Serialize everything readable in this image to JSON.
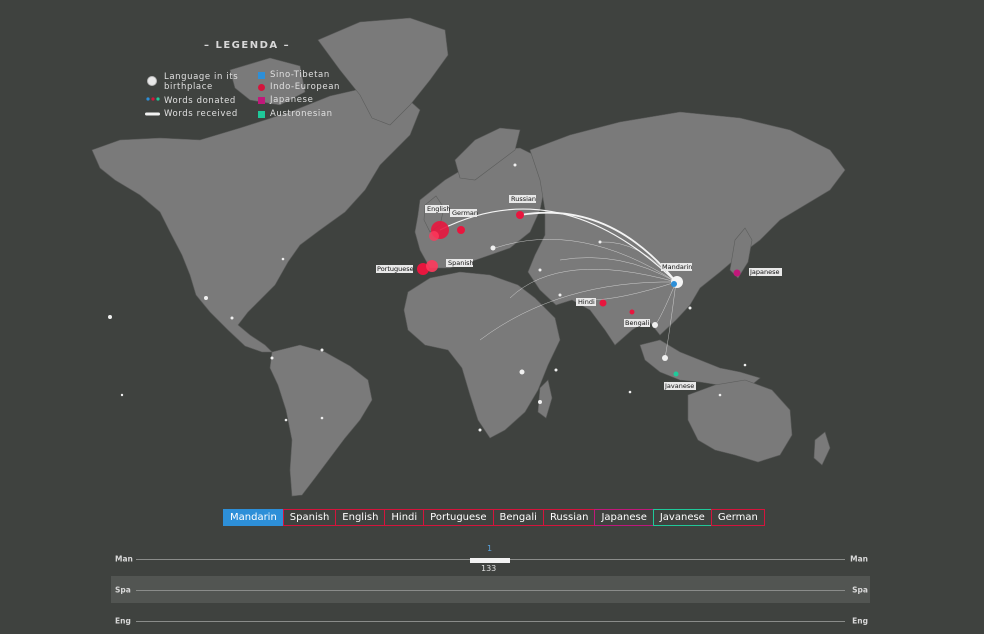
{
  "legend": {
    "title": "– LEGENDA –",
    "items_left": [
      {
        "label": "Language in its birthplace",
        "icon": "white-circle-icon"
      },
      {
        "label": "Words donated",
        "icon": "dotted-line-icon"
      },
      {
        "label": "Words received",
        "icon": "white-line-icon"
      }
    ],
    "families": [
      {
        "label": "Sino-Tibetan",
        "color": "#2d8fd8"
      },
      {
        "label": "Indo-European",
        "color": "#d4143c"
      },
      {
        "label": "Japanese",
        "color": "#c0187a"
      },
      {
        "label": "Austronesian",
        "color": "#1fc99a"
      }
    ]
  },
  "map_labels": {
    "english": "English",
    "german": "German",
    "russian": "Russian",
    "portuguese": "Portuguese",
    "spanish": "Spanish",
    "mandarin": "Mandarin",
    "hindi": "Hindi",
    "bengali": "Bengali",
    "japanese": "Japanese",
    "javanese": "Javanese"
  },
  "tabs": [
    "Mandarin",
    "Spanish",
    "English",
    "Hindi",
    "Portuguese",
    "Bengali",
    "Russian",
    "Japanese",
    "Javanese",
    "German"
  ],
  "active_tab": "Mandarin",
  "rows": [
    {
      "left": "Man",
      "right": "Man"
    },
    {
      "left": "Spa",
      "right": "Spa"
    },
    {
      "left": "Eng",
      "right": "Eng"
    }
  ],
  "slider": {
    "top_value": "1",
    "bottom_value": "133"
  }
}
